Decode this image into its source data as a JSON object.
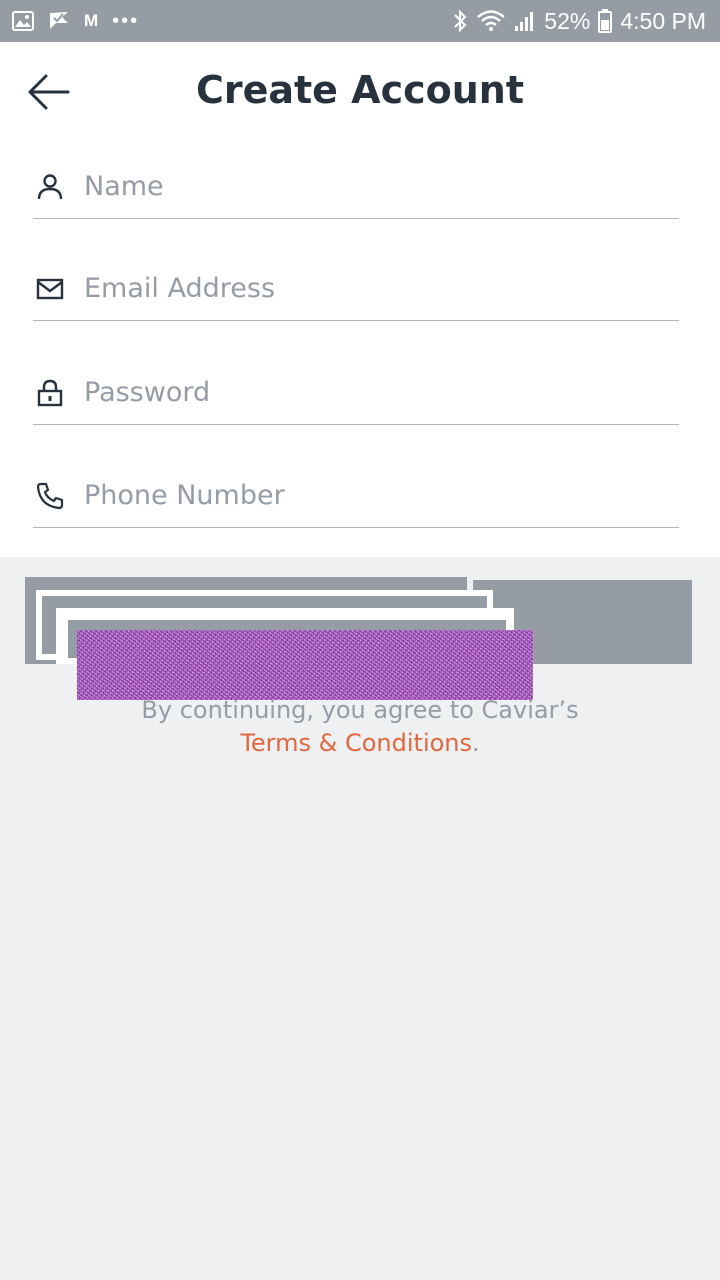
{
  "status_bar": {
    "left_icons": [
      "gallery-icon",
      "check-flag-icon",
      "gmail-icon",
      "more-dots-icon"
    ],
    "gmail_glyph": "M",
    "dots_glyph": "•••",
    "battery_percent": "52%",
    "time": "4:50 PM"
  },
  "header": {
    "title": "Create Account"
  },
  "form": {
    "name": {
      "placeholder": "Name",
      "value": ""
    },
    "email": {
      "placeholder": "Email Address",
      "value": ""
    },
    "password": {
      "placeholder": "Password",
      "value": ""
    },
    "phone": {
      "placeholder": "Phone Number",
      "value": ""
    }
  },
  "terms": {
    "text": "By continuing, you agree to Caviar’s",
    "link": "Terms & Conditions",
    "suffix": "."
  },
  "colors": {
    "status_bar": "#969ca4",
    "title": "#28323c",
    "placeholder": "#969ca4",
    "link_accent": "#e2663e",
    "background": "#eef0f2"
  }
}
